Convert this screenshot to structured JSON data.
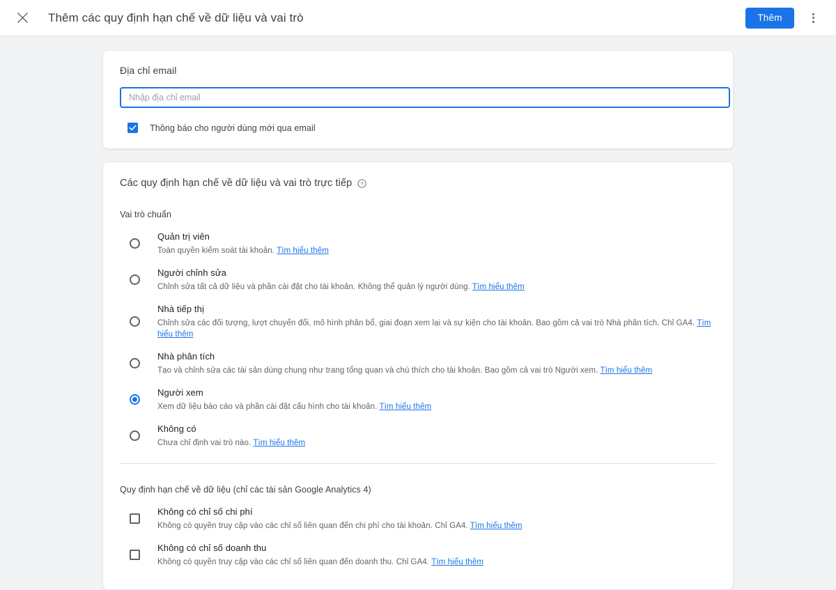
{
  "header": {
    "close_icon": "close-icon",
    "title": "Thêm các quy định hạn chế về dữ liệu và vai trò",
    "primary_button": "Thêm",
    "overflow_icon": "more-vert-icon"
  },
  "email_card": {
    "label": "Địa chỉ email",
    "input_placeholder": "Nhập địa chỉ email",
    "input_value": "",
    "notify_checkbox": {
      "label": "Thông báo cho người dùng mới qua email",
      "checked": true
    }
  },
  "roles_card": {
    "section_title": "Các quy định hạn chế về dữ liệu và vai trò trực tiếp",
    "help_icon": "help-circle-icon",
    "standard_roles_label": "Vai trò chuẩn",
    "roles": [
      {
        "title": "Quản trị viên",
        "desc": "Toàn quyền kiểm soát tài khoản.",
        "link": "Tìm hiểu thêm",
        "selected": false
      },
      {
        "title": "Người chỉnh sửa",
        "desc": "Chỉnh sửa tất cả dữ liệu và phần cài đặt cho tài khoản. Không thể quản lý người dùng.",
        "link": "Tìm hiểu thêm",
        "selected": false
      },
      {
        "title": "Nhà tiếp thị",
        "desc": "Chỉnh sửa các đối tượng, lượt chuyển đổi, mô hình phân bổ, giai đoạn xem lại và sự kiện cho tài khoản. Bao gồm cả vai trò Nhà phân tích. Chỉ GA4.",
        "link": "Tìm hiểu thêm",
        "selected": false
      },
      {
        "title": "Nhà phân tích",
        "desc": "Tạo và chỉnh sửa các tài sản dùng chung như trang tổng quan và chú thích cho tài khoản. Bao gồm cả vai trò Người xem.",
        "link": "Tìm hiểu thêm",
        "selected": false
      },
      {
        "title": "Người xem",
        "desc": "Xem dữ liệu báo cáo và phần cài đặt cấu hình cho tài khoản.",
        "link": "Tìm hiểu thêm",
        "selected": true
      },
      {
        "title": "Không có",
        "desc": "Chưa chỉ định vai trò nào.",
        "link": "Tìm hiểu thêm",
        "selected": false
      }
    ],
    "data_restrictions_label": "Quy định hạn chế về dữ liệu (chỉ các tài sản Google Analytics 4)",
    "restrictions": [
      {
        "title": "Không có chỉ số chi phí",
        "desc": "Không có quyền truy cập vào các chỉ số liên quan đến chi phí cho tài khoản. Chỉ GA4.",
        "link": "Tìm hiểu thêm",
        "checked": false
      },
      {
        "title": "Không có chỉ số doanh thu",
        "desc": "Không có quyền truy cập vào các chỉ số liên quan đến doanh thu. Chỉ GA4.",
        "link": "Tìm hiểu thêm",
        "checked": false
      }
    ]
  },
  "colors": {
    "accent": "#1a73e8",
    "page_bg": "#f1f3f4",
    "card_bg": "#ffffff",
    "text_primary": "#202124",
    "text_secondary": "#5f6368"
  }
}
